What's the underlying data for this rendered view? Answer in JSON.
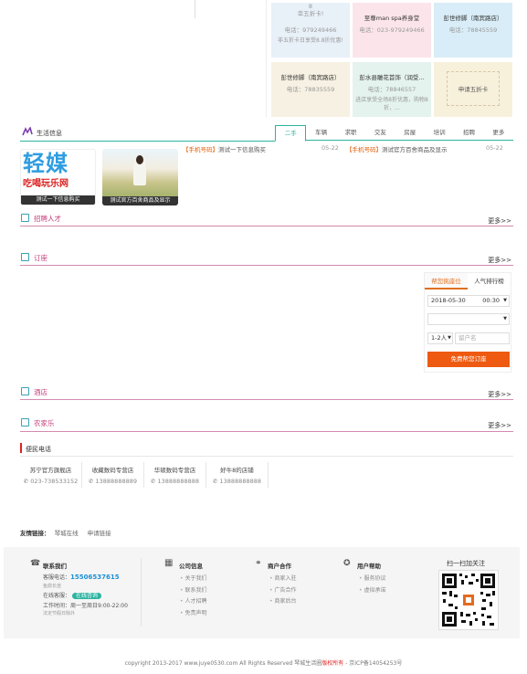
{
  "top_cards": [
    {
      "title": "幸五折卡!",
      "phone": "电话：979249466",
      "desc": "非五折卡日享受8.8折优惠!",
      "top_text": "8",
      "color": "blue"
    },
    {
      "title": "至尊man spa养身堂",
      "phone": "电话：023-979249466",
      "desc": "",
      "color": "pink"
    },
    {
      "title": "彭世修脚（南宾路店）",
      "phone": "电话：78845559",
      "desc": "",
      "color": "cyan"
    },
    {
      "title": "彭世修脚（南宾路店）",
      "phone": "电话：78835559",
      "desc": "",
      "color": "beige"
    },
    {
      "title": "彭水县雕花首饰（润受...",
      "phone": "电话：78846557",
      "desc": "进店享受全场8折优惠，购物8折，...",
      "color": "mint"
    },
    {
      "title": "申请五折卡",
      "color": "yel"
    }
  ],
  "life_info": {
    "title": "生活信息",
    "tabs": [
      "二手",
      "车辆",
      "求职",
      "交友",
      "房屋",
      "培训",
      "招聘",
      "更多"
    ],
    "active_tab": 0,
    "news": [
      {
        "tag": "【手机号码】",
        "text": "测试一下信息购买",
        "date": "05-22"
      },
      {
        "tag": "【手机号码】",
        "text": "测试官方百舍商品及显示",
        "date": "05-22"
      }
    ],
    "thumbs": [
      {
        "caption": "测试一下信息购买",
        "logo_top": "轻媒",
        "logo_bottom": "吃喝玩乐网"
      },
      {
        "caption": "测试官方百舍商品及显示"
      }
    ]
  },
  "sections": {
    "recruit": "招聘人才",
    "booking": "订座",
    "hotel": "酒店",
    "farm": "农家乐",
    "more": "更多>>"
  },
  "widget": {
    "tabs": [
      "帮您挑座位",
      "人气排行榜"
    ],
    "date": "2018-05-30",
    "time": "00:30",
    "people": "1-2人",
    "phone_placeholder": "留户名",
    "button": "免费帮您订座"
  },
  "convenience": {
    "title": "便民电话",
    "stores": [
      {
        "name": "苏宁官方旗舰店",
        "phone": "023-738533152"
      },
      {
        "name": "收藏数码专营店",
        "phone": "13888888889"
      },
      {
        "name": "华硕数码专营店",
        "phone": "13888888888"
      },
      {
        "name": "好牛8的店铺",
        "phone": "13888888888"
      }
    ]
  },
  "friend_links": {
    "label": "友情链接：",
    "links": [
      "琴城在线",
      "申请链接"
    ]
  },
  "footer": {
    "contact": {
      "title": "联系我们",
      "phone_label": "客服电话：",
      "phone": "15506537615",
      "sub": "鱼鼎长途",
      "online_label": "在线客服：",
      "online_btn": "在线咨询",
      "hours": "工作时间：周一至周日9:00-22:00",
      "note": "法定节假日除外"
    },
    "company": {
      "title": "公司信息",
      "links": [
        "关于我们",
        "联系我们",
        "人才招聘",
        "免责声明"
      ]
    },
    "merchant": {
      "title": "商户合作",
      "links": [
        "商家入驻",
        "广告合作",
        "商家后台"
      ]
    },
    "help": {
      "title": "用户帮助",
      "links": [
        "服务协议",
        "虚拟承诺"
      ]
    },
    "qr_title": "扫一扫加关注",
    "copyright": "copyright 2013-2017 www.juye0530.com All Rights Reserved 琴城生活圈",
    "copyright_red": "版权所有",
    "icp": "- 京ICP备14054253号"
  },
  "colors": {
    "accent": "#2bb3a0",
    "orange": "#ee5a11",
    "section": "#c63d7a",
    "blue": "#1b8fd6"
  }
}
